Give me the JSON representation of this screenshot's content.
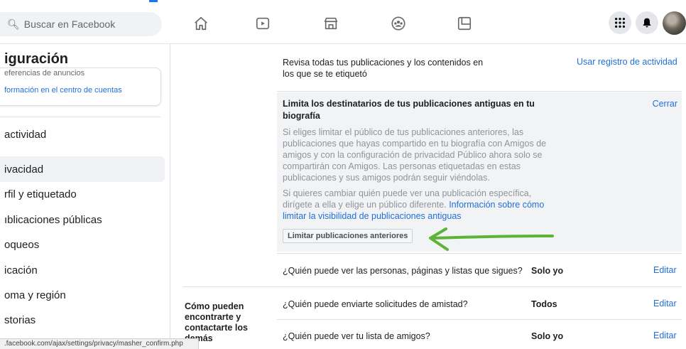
{
  "topbar": {
    "search_placeholder": "Buscar en Facebook",
    "nav_icons": [
      "home-icon",
      "watch-icon",
      "marketplace-icon",
      "groups-icon",
      "gaming-icon"
    ],
    "right_icons": [
      "menu-grid-icon",
      "notifications-icon",
      "avatar"
    ]
  },
  "sidebar": {
    "title": "iguración",
    "card_line1": "eferencias de anuncios",
    "card_line2": "formación en el centro de cuentas",
    "items": [
      {
        "label": "actividad"
      },
      {
        "label": "ivacidad"
      },
      {
        "label": "rfil y etiquetado"
      },
      {
        "label": "ıblicaciones públicas"
      },
      {
        "label": "oqueos"
      },
      {
        "label": "icación"
      },
      {
        "label": "oma y región"
      },
      {
        "label": "storias"
      }
    ],
    "active_index": 1
  },
  "main": {
    "review_text": "Revisa todas tus publicaciones y los contenidos en los que se te etiquetó",
    "review_action": "Usar registro de actividad",
    "limit_panel": {
      "title": "Limita los destinatarios de tus publicaciones antiguas en tu biografía",
      "close": "Cerrar",
      "para1": "Si eliges limitar el público de tus publicaciones anteriores, las publicaciones que hayas compartido en tu biografía con Amigos de amigos y con la configuración de privacidad Público ahora solo se compartirán con Amigos. Las personas etiquetadas en estas publicaciones y sus amigos podrán seguir viéndolas.",
      "para2_prefix": "Si quieres cambiar quién puede ver una publicación específica, dirígete a ella y elige un público diferente.",
      "para2_link": "Información sobre cómo limitar la visibilidad de publicaciones antiguas",
      "button": "Limitar publicaciones anteriores"
    },
    "following_row": {
      "question": "¿Quién puede ver las personas, páginas y listas que sigues?",
      "value": "Solo yo",
      "action": "Editar"
    },
    "section_title": "Cómo pueden encontrarte y contactarte los demás",
    "friend_requests_row": {
      "question": "¿Quién puede enviarte solicitudes de amistad?",
      "value": "Todos",
      "action": "Editar"
    },
    "friends_list_row": {
      "question": "¿Quién puede ver tu lista de amigos?",
      "value": "Solo yo",
      "action": "Editar"
    }
  },
  "statusbar": {
    "url": ".facebook.com/ajax/settings/privacy/masher_confirm.php"
  },
  "colors": {
    "link": "#216fdb",
    "arrow": "#5cb335",
    "panel_bg": "#f2f3f5"
  }
}
